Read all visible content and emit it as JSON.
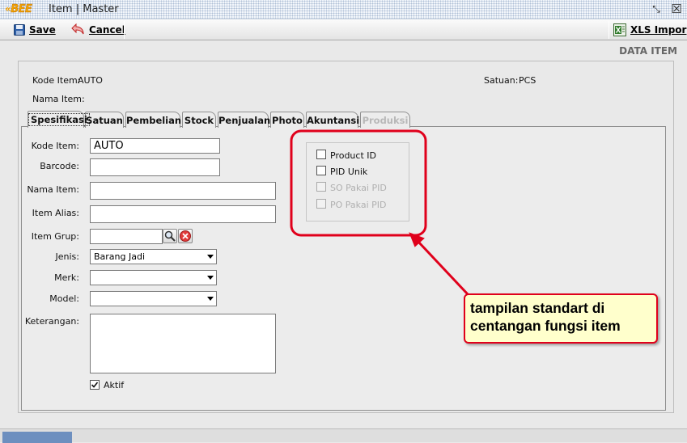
{
  "window": {
    "logo_chevron": "«",
    "logo_text": "BEE",
    "title": "Item | Master",
    "restore_glyph": "⤡",
    "close_glyph": "☒"
  },
  "toolbar": {
    "save_label": "Save",
    "cancel_label": "Cancel",
    "xls_label": "XLS Impor"
  },
  "page_heading": "DATA ITEM",
  "header": {
    "kode_item_label": "Kode Item:",
    "kode_item_value": "AUTO",
    "nama_item_label": "Nama Item:",
    "satuan_label": "Satuan:",
    "satuan_value": "PCS"
  },
  "tabs": [
    {
      "label": "Spesifikasi",
      "active": true,
      "disabled": false
    },
    {
      "label": "Satuan",
      "active": false,
      "disabled": false
    },
    {
      "label": "Pembelian",
      "active": false,
      "disabled": false
    },
    {
      "label": "Stock",
      "active": false,
      "disabled": false
    },
    {
      "label": "Penjualan",
      "active": false,
      "disabled": false
    },
    {
      "label": "Photo",
      "active": false,
      "disabled": false
    },
    {
      "label": "Akuntansi",
      "active": false,
      "disabled": false
    },
    {
      "label": "Produksi",
      "active": false,
      "disabled": true
    }
  ],
  "form": {
    "kode_item": {
      "label": "Kode Item:",
      "value": "AUTO"
    },
    "barcode": {
      "label": "Barcode:",
      "value": ""
    },
    "nama_item": {
      "label": "Nama Item:",
      "value": ""
    },
    "item_alias": {
      "label": "Item Alias:",
      "value": ""
    },
    "item_grup": {
      "label": "Item Grup:",
      "value": ""
    },
    "jenis": {
      "label": "Jenis:",
      "value": "Barang Jadi"
    },
    "merk": {
      "label": "Merk:",
      "value": ""
    },
    "model": {
      "label": "Model:",
      "value": ""
    },
    "keterangan": {
      "label": "Keterangan:",
      "value": ""
    },
    "aktif": {
      "label": "Aktif",
      "checked": true
    }
  },
  "pid_options": [
    {
      "label": "Product ID",
      "checked": false,
      "enabled": true
    },
    {
      "label": "PID Unik",
      "checked": false,
      "enabled": true
    },
    {
      "label": "SO Pakai PID",
      "checked": false,
      "enabled": false
    },
    {
      "label": "PO Pakai PID",
      "checked": false,
      "enabled": false
    }
  ],
  "annotation": {
    "text": "tampilan standart di centangan fungsi item",
    "border_color": "#e0001b",
    "fill_color": "#ffffcc"
  },
  "colors": {
    "status_accent": "#6d8fbf",
    "logo": "#f5a400"
  },
  "icons": {
    "save": "floppy-disk-icon",
    "cancel": "undo-arrow-icon",
    "xls": "excel-icon",
    "lookup": "magnifier-icon",
    "clear": "red-x-icon"
  }
}
